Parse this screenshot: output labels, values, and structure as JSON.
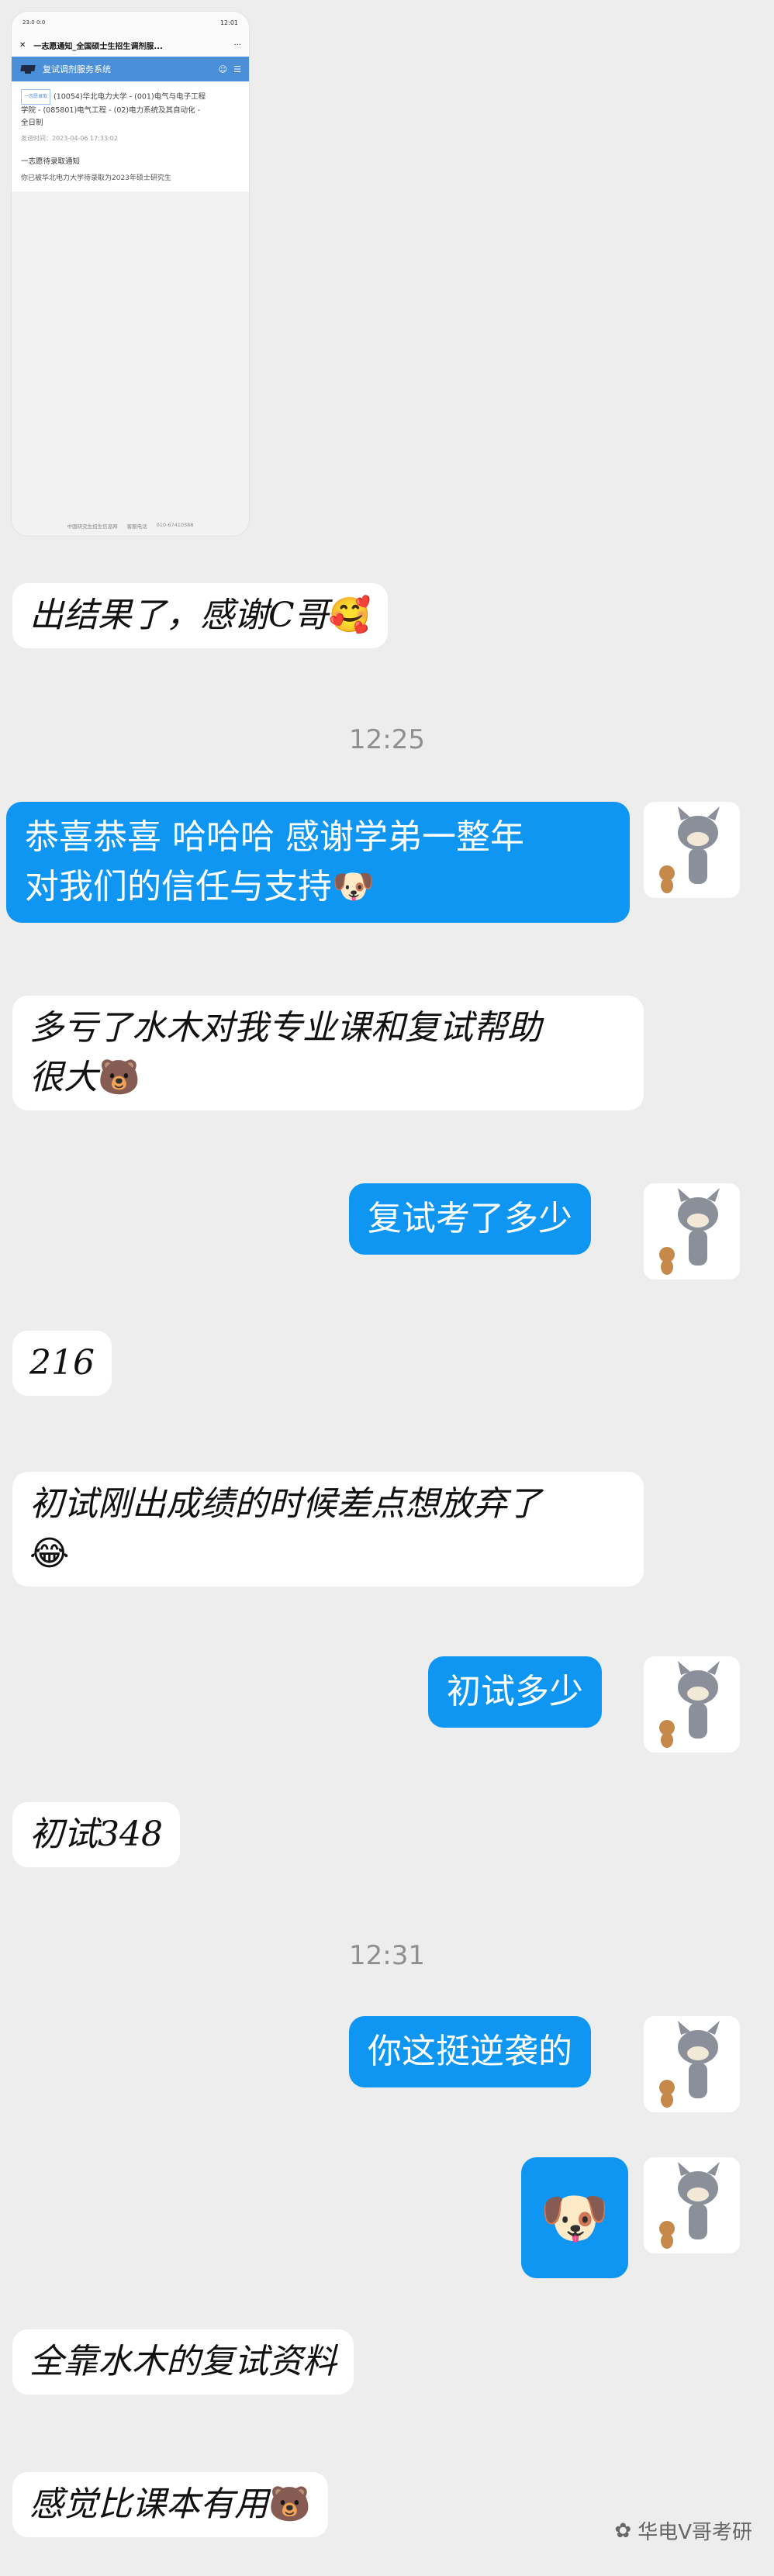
{
  "screenshot": {
    "status_left": "23:0\n0:0",
    "status_right": "12:01",
    "nav_title": "一志愿通知_全国硕士生招生调剂服...",
    "nav_close": "✕",
    "nav_more": "···",
    "bar_title": "复试调剂服务系统",
    "card": {
      "tag": "一志愿录取",
      "line1": "(10054)华北电力大学 - (001)电气与电子工程",
      "line2": "学院 - (085801)电气工程 - (02)电力系统及其自动化 -",
      "line3": "全日制",
      "time": "发送时间：2023-04-06 17:33:02"
    },
    "notice_title": "一志愿待录取通知",
    "notice_text": "你已被华北电力大学待录取为2023年硕士研究生",
    "footer_left": "中国研究生招生信息网",
    "footer_mid": "客服电话",
    "footer_right": "010-67410388"
  },
  "messages": [
    {
      "side": "in",
      "text": "出结果了，感谢C哥",
      "emoji": "🥰"
    },
    {
      "time": "12:25"
    },
    {
      "side": "out",
      "line1": "恭喜恭喜 哈哈哈 感谢学弟一整年",
      "line2": "对我们的信任与支持",
      "emoji": "🐶"
    },
    {
      "side": "in",
      "line1": "多亏了水木对我专业课和复试帮助",
      "line2": "很大",
      "emoji": "🐻"
    },
    {
      "side": "out",
      "text": "复试考了多少"
    },
    {
      "side": "in",
      "text": "216"
    },
    {
      "side": "in",
      "line1": "初试刚出成绩的时候差点想放弃了",
      "emoji": "😂"
    },
    {
      "side": "out",
      "text": "初试多少"
    },
    {
      "side": "in",
      "text": "初试348"
    },
    {
      "time": "12:31"
    },
    {
      "side": "out",
      "text": "你这挺逆袭的"
    },
    {
      "side": "out",
      "sticker": "🐶"
    },
    {
      "side": "in",
      "text": "全靠水木的复试资料"
    },
    {
      "side": "in",
      "text": "感觉比课本有用",
      "emoji": "🐻"
    }
  ],
  "watermark": "华电V哥考研"
}
